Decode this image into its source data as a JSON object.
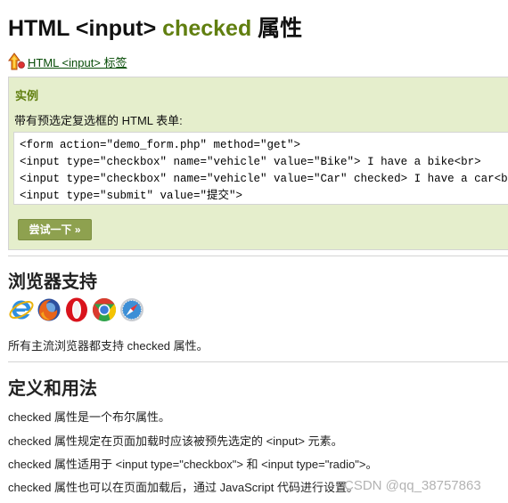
{
  "page": {
    "title_prefix": "HTML <input> ",
    "title_accent": "checked",
    "title_suffix": " 属性"
  },
  "back_link": {
    "label": " HTML <input> 标签",
    "icon": "back-arrow-icon"
  },
  "example": {
    "heading": "实例",
    "description": "带有预选定复选框的 HTML 表单:",
    "code_lines": [
      "<form action=\"demo_form.php\" method=\"get\">",
      "<input type=\"checkbox\" name=\"vehicle\" value=\"Bike\"> I have a bike<br>",
      "<input type=\"checkbox\" name=\"vehicle\" value=\"Car\" checked> I have a car<br>",
      "<input type=\"submit\" value=\"提交\">"
    ],
    "try_button": "尝试一下 »",
    "colors": {
      "box_bg": "#e5eecc",
      "button_bg": "#8ea14f",
      "accent": "#617f10"
    }
  },
  "browser_support": {
    "heading": "浏览器支持",
    "icons": [
      "internet-explorer-icon",
      "firefox-icon",
      "opera-icon",
      "chrome-icon",
      "safari-icon"
    ],
    "text": "所有主流浏览器都支持 checked 属性。"
  },
  "definition": {
    "heading": "定义和用法",
    "paragraphs": [
      "checked 属性是一个布尔属性。",
      "checked 属性规定在页面加载时应该被预先选定的 <input> 元素。",
      "checked 属性适用于 <input type=\"checkbox\"> 和 <input type=\"radio\">。",
      "checked 属性也可以在页面加载后，通过 JavaScript 代码进行设置。"
    ]
  },
  "watermark": "CSDN @qq_38757863"
}
